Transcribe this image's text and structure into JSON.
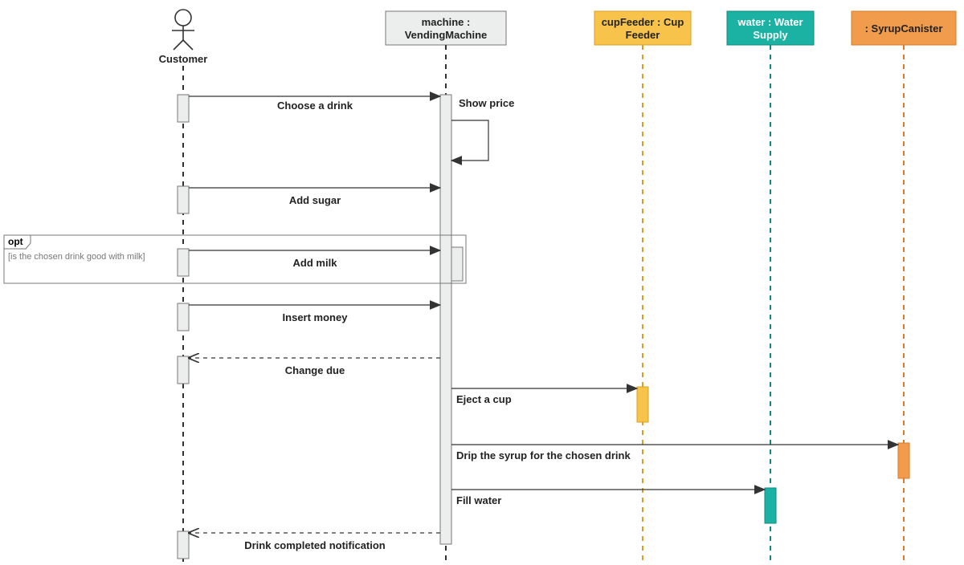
{
  "actor": {
    "name": "Customer"
  },
  "participants": {
    "machine": {
      "label1": "machine :",
      "label2": "VendingMachine"
    },
    "cupFeeder": {
      "label1": "cupFeeder : Cup",
      "label2": "Feeder"
    },
    "water": {
      "label1": "water : Water",
      "label2": "Supply"
    },
    "syrup": {
      "label1": ": SyrupCanister"
    }
  },
  "fragment": {
    "operator": "opt",
    "guard": "[is the chosen drink good with milk]"
  },
  "messages": {
    "chooseDrink": "Choose a drink",
    "showPrice": "Show price",
    "addSugar": "Add sugar",
    "addMilk": "Add milk",
    "insertMoney": "Insert money",
    "changeDue": "Change due",
    "ejectCup": "Eject a cup",
    "dripSyrup": "Drip the syrup for the chosen drink",
    "fillWater": "Fill water",
    "drinkDone": "Drink completed notification"
  }
}
